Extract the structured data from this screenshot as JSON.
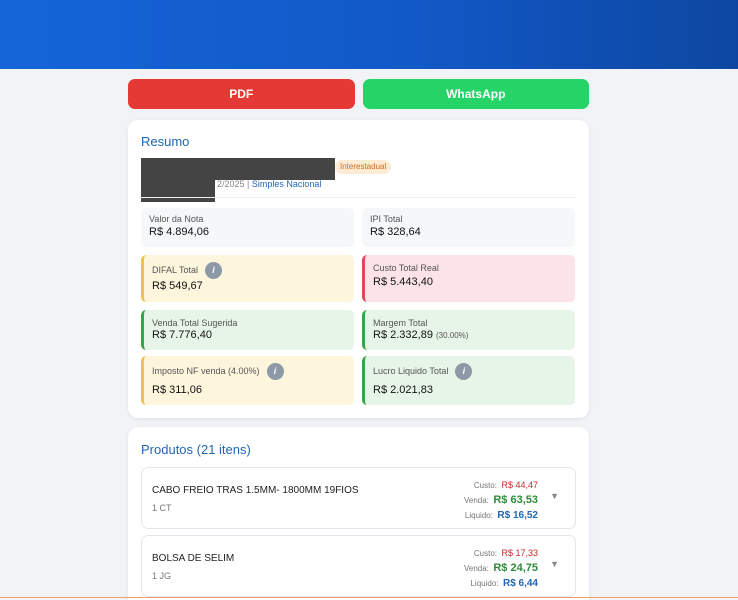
{
  "buttons": {
    "pdf": "PDF",
    "whatsapp": "WhatsApp"
  },
  "resumo": {
    "title": "Resumo",
    "badge": "Interestadual",
    "date_fragment": "2/2025",
    "separator": " | ",
    "regime": "Simples Nacional",
    "tiles": {
      "valor_nota": {
        "label": "Valor da Nota",
        "value": "R$ 4.894,06"
      },
      "ipi_total": {
        "label": "IPI Total",
        "value": "R$ 328,64"
      },
      "difal_total": {
        "label": "DIFAL Total",
        "value": "R$ 549,67"
      },
      "custo_total_real": {
        "label": "Custo Total Real",
        "value": "R$ 5.443,40"
      },
      "venda_total": {
        "label": "Venda Total Sugerida",
        "value": "R$ 7.776,40"
      },
      "margem_total": {
        "label": "Margem Total",
        "value": "R$ 2.332,89",
        "pct": "(30.00%)"
      },
      "imposto_nf": {
        "label": "Imposto NF venda (4.00%)",
        "value": "R$ 311,06"
      },
      "lucro_liquido": {
        "label": "Lucro Liquido Total",
        "value": "R$ 2.021,83"
      }
    }
  },
  "produtos": {
    "title": "Produtos (21 itens)",
    "labels": {
      "custo": "Custo:",
      "venda": "Venda:",
      "liquido": "Liquido:"
    },
    "items": [
      {
        "name": "CABO FREIO TRAS 1.5MM- 1800MM 19FIOS",
        "qty": "1 CT",
        "custo": "R$ 44,47",
        "venda": "R$ 63,53",
        "liquido": "R$ 16,52"
      },
      {
        "name": "BOLSA DE SELIM",
        "qty": "1 JG",
        "custo": "R$ 17,33",
        "venda": "R$ 24,75",
        "liquido": "R$ 6,44"
      }
    ]
  },
  "icons": {
    "info": "i",
    "chevron": "▼"
  },
  "colors": {
    "header": "#1565d8",
    "pdf": "#e53935",
    "whatsapp": "#25d366",
    "accent": "#1f66b5"
  }
}
